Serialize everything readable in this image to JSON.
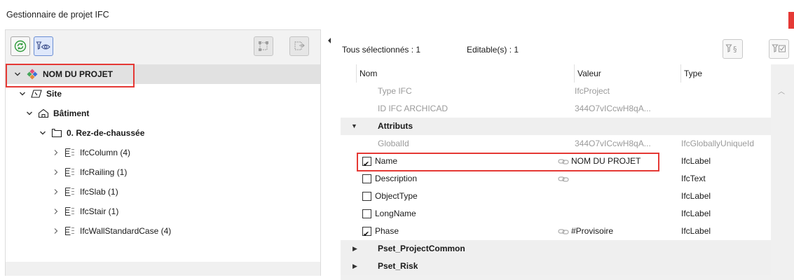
{
  "window": {
    "title": "Gestionnaire de projet IFC"
  },
  "tree": {
    "items": [
      {
        "label": "NOM DU PROJET",
        "icon": "project-icon"
      },
      {
        "label": "Site",
        "icon": "site-icon"
      },
      {
        "label": "Bâtiment",
        "icon": "building-icon"
      },
      {
        "label": "0. Rez-de-chaussée",
        "icon": "storey-icon"
      },
      {
        "label": "IfcColumn (4)",
        "icon": "element-list-icon"
      },
      {
        "label": "IfcRailing (1)",
        "icon": "element-list-icon"
      },
      {
        "label": "IfcSlab (1)",
        "icon": "element-list-icon"
      },
      {
        "label": "IfcStair (1)",
        "icon": "element-list-icon"
      },
      {
        "label": "IfcWallStandardCase (4)",
        "icon": "element-list-icon"
      }
    ]
  },
  "right": {
    "selected_label": "Tous sélectionnés : 1",
    "editable_label": "Editable(s) : 1",
    "columns": [
      "Nom",
      "Valeur",
      "Type"
    ],
    "rows": [
      {
        "name": "Type IFC",
        "value": "IfcProject",
        "type": ""
      },
      {
        "name": "ID IFC ARCHICAD",
        "value": "344O7vICcwH8qA...",
        "type": ""
      },
      {
        "group": "Attributs"
      },
      {
        "name": "GlobalId",
        "value": "344O7vICcwH8qA...",
        "type": "IfcGloballyUniqueId"
      },
      {
        "name": "Name",
        "value": "NOM DU PROJET",
        "type": "IfcLabel",
        "checked": true
      },
      {
        "name": "Description",
        "value": "",
        "type": "IfcText",
        "checked": false
      },
      {
        "name": "ObjectType",
        "value": "",
        "type": "IfcLabel",
        "checked": false
      },
      {
        "name": "LongName",
        "value": "",
        "type": "IfcLabel",
        "checked": false
      },
      {
        "name": "Phase",
        "value": "#Provisoire",
        "type": "IfcLabel",
        "checked": true
      },
      {
        "group": "Pset_ProjectCommon"
      },
      {
        "group": "Pset_Risk"
      }
    ]
  },
  "colors": {
    "highlight": "#e53935",
    "selection": "#e1e1e1",
    "accent": "#6b8fd3"
  }
}
